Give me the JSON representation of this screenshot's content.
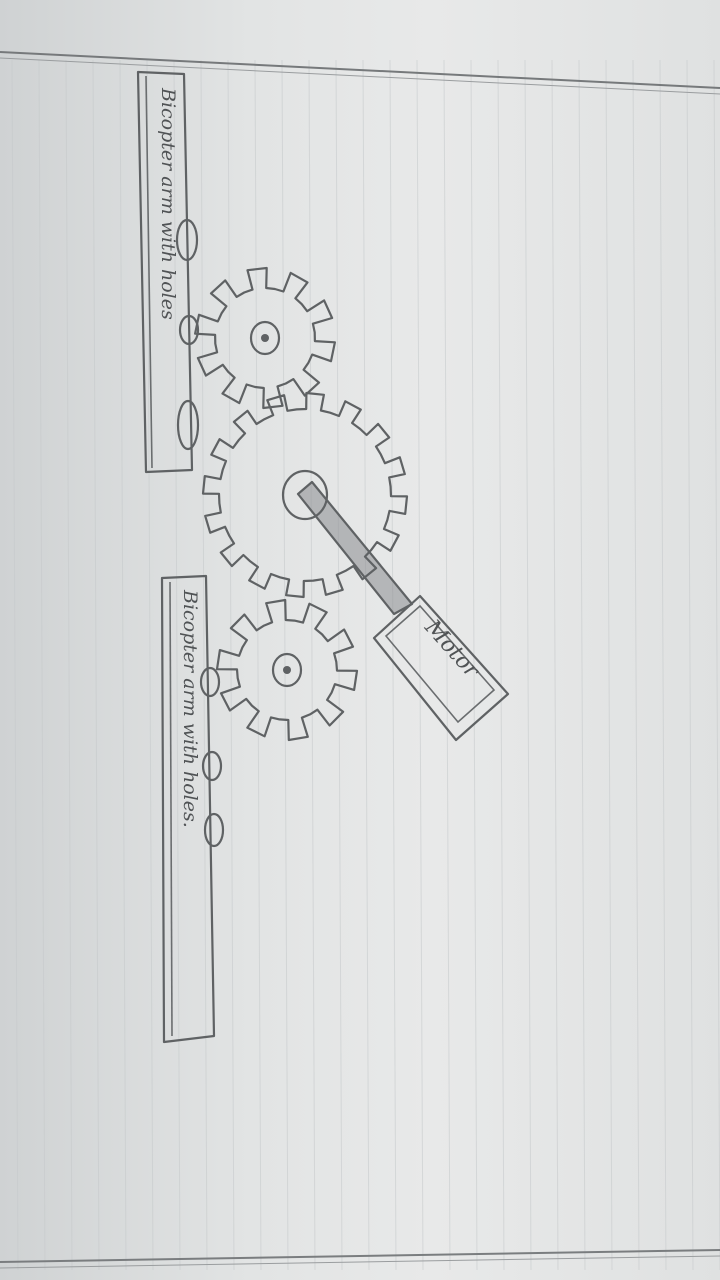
{
  "diagram": {
    "labels": {
      "top_arm": "Bicopter arm with holes",
      "bottom_arm": "Bicopter arm with holes.",
      "motor": "Motor"
    },
    "components": [
      {
        "id": "top-arm",
        "type": "arm",
        "holes": 3
      },
      {
        "id": "top-gear",
        "type": "gear",
        "teeth": 10
      },
      {
        "id": "center-gear",
        "type": "gear",
        "teeth": 16
      },
      {
        "id": "bottom-gear",
        "type": "gear",
        "teeth": 10
      },
      {
        "id": "bottom-arm",
        "type": "arm",
        "holes": 3
      },
      {
        "id": "motor",
        "type": "motor"
      }
    ],
    "colors": {
      "pencil": "#5f6264",
      "paper": "#e4e6e6",
      "rule_line": "#c4c8ca"
    }
  }
}
